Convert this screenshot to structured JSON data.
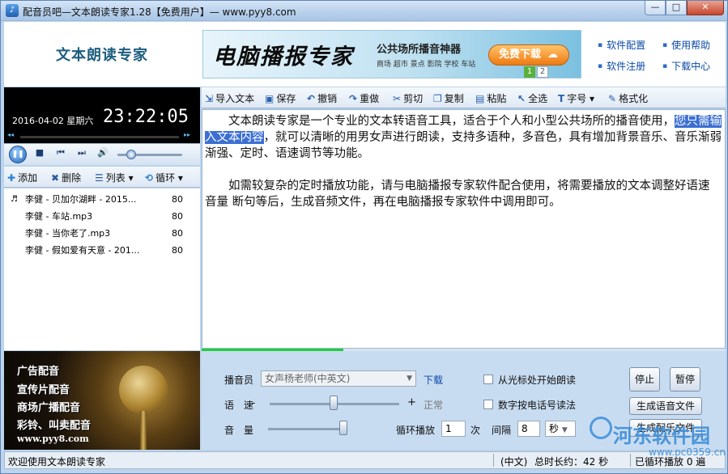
{
  "window": {
    "title": "配音员吧—文本朗读专家1.28【免费用户】— www.pyy8.com",
    "min_symbol": "—",
    "max_symbol": "□",
    "close_symbol": "✕"
  },
  "header": {
    "brand": "文本朗读专家",
    "banner": {
      "title": "电脑播报专家",
      "subtitle": "公共场所播音神器",
      "subtitle2": "商场 超市 景点 影院 学校 车站",
      "button": "免费下载",
      "pages": [
        "1",
        "2"
      ]
    },
    "links": [
      "软件配置",
      "使用帮助",
      "软件注册",
      "下载中心"
    ]
  },
  "player": {
    "date": "2016-04-02 星期六",
    "clock": "23:22:05",
    "seek_progress": 0.1,
    "volume_level": 0.15
  },
  "playlist_toolbar": {
    "add": "添加",
    "delete": "删除",
    "list": "列表",
    "loop": "循环"
  },
  "playlist": [
    {
      "name": "李健 - 贝加尔湖畔 - 2015...",
      "volume": "80",
      "playing": true
    },
    {
      "name": "李健 - 车站.mp3",
      "volume": "80",
      "playing": false
    },
    {
      "name": "李健 - 当你老了.mp3",
      "volume": "80",
      "playing": false
    },
    {
      "name": "李健 - 假如爱有天意 - 201...",
      "volume": "80",
      "playing": false
    }
  ],
  "ad": {
    "lines": [
      "广告配音",
      "宣传片配音",
      "商场广播配音",
      "彩铃、叫卖配音"
    ],
    "url": "www.pyy8.com"
  },
  "toolbar": {
    "import": "导入文本",
    "save": "保存",
    "undo": "撤销",
    "redo": "重做",
    "cut": "剪切",
    "copy": "复制",
    "paste": "粘贴",
    "select_all": "全选",
    "font": "字号",
    "format": "格式化"
  },
  "editor": {
    "p1_before": "文本朗读专家是一个专业的文本转语音工具，适合于个人和小型公共场所的播音使用，",
    "p1_selected": "您只需输入文本内容",
    "p1_after": "，就可以清晰的用男女声进行朗读，支持多语种，多音色，具有增加背景音乐、音乐渐弱渐强、定时、语速调节等功能。",
    "p2": "如需较复杂的定时播放功能，请与电脑播报专家软件配合使用，将需要播放的文本调整好语速 音量 断句等后，生成音频文件，再在电脑播报专家软件中调用即可。",
    "progress": 0.27
  },
  "settings": {
    "reader_label": "播音员",
    "reader_value": "女声杨老师(中英文)",
    "download_link": "下载",
    "speed_label": "语　速",
    "speed_minus": "-",
    "speed_plus": "+",
    "speed_value": "正常",
    "volume_label": "音　量",
    "loop_label": "循环播放",
    "loop_count": "1",
    "times_label": "次",
    "interval_label": "间隔",
    "interval_value": "8",
    "interval_unit": "秒",
    "cursor_start": "从光标处开始朗读",
    "digits_as_phone": "数字按电话号读法",
    "stop": "停止",
    "pause": "暂停",
    "gen_voice": "生成语音文件",
    "gen_ad": "生成配乐文件"
  },
  "status": {
    "message": "欢迎使用文本朗读专家",
    "lang": "(中文)",
    "duration": "总时长约：42 秒",
    "loop": "已循环播放 0 遍"
  },
  "watermark": {
    "text": "河东软件园",
    "url": "www.pc0359.cn"
  }
}
